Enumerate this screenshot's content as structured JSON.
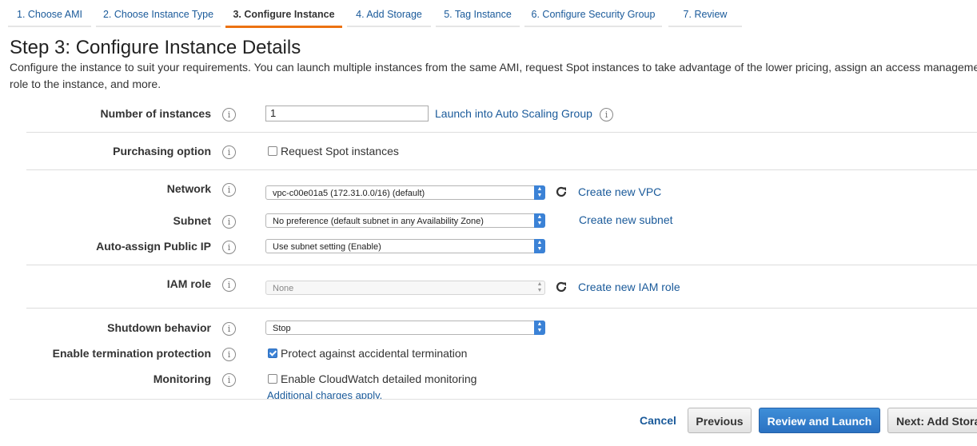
{
  "tabs": [
    {
      "label": "1. Choose AMI"
    },
    {
      "label": "2. Choose Instance Type"
    },
    {
      "label": "3. Configure Instance"
    },
    {
      "label": "4. Add Storage"
    },
    {
      "label": "5. Tag Instance"
    },
    {
      "label": "6. Configure Security Group"
    },
    {
      "label": "7. Review"
    }
  ],
  "page": {
    "title": "Step 3: Configure Instance Details",
    "description_line1": "Configure the instance to suit your requirements. You can launch multiple instances from the same AMI, request Spot instances to take advantage of the lower pricing, assign an access management",
    "description_line2": "role to the instance, and more."
  },
  "info_glyph": "i",
  "form": {
    "number_of_instances": {
      "label": "Number of instances",
      "value": "1",
      "link": "Launch into Auto Scaling Group"
    },
    "purchasing_option": {
      "label": "Purchasing option",
      "checkbox_label": "Request Spot instances",
      "checked": false
    },
    "network": {
      "label": "Network",
      "value": "vpc-c00e01a5 (172.31.0.0/16) (default)",
      "link": "Create new VPC"
    },
    "subnet": {
      "label": "Subnet",
      "value": "No preference (default subnet in any Availability Zone)",
      "link": "Create new subnet"
    },
    "auto_assign_ip": {
      "label": "Auto-assign Public IP",
      "value": "Use subnet setting (Enable)"
    },
    "iam_role": {
      "label": "IAM role",
      "value": "None",
      "link": "Create new IAM role"
    },
    "shutdown_behavior": {
      "label": "Shutdown behavior",
      "value": "Stop"
    },
    "termination_protection": {
      "label": "Enable termination protection",
      "checkbox_label": "Protect against accidental termination",
      "checked": true
    },
    "monitoring": {
      "label": "Monitoring",
      "checkbox_label": "Enable CloudWatch detailed monitoring",
      "checked": false,
      "note": "Additional charges apply."
    }
  },
  "footer": {
    "cancel": "Cancel",
    "previous": "Previous",
    "review_launch": "Review and Launch",
    "next": "Next: Add Storage"
  },
  "colors": {
    "accent": "#ec7211",
    "link": "#1a5a9a",
    "primary_button": "#2b72c2"
  }
}
